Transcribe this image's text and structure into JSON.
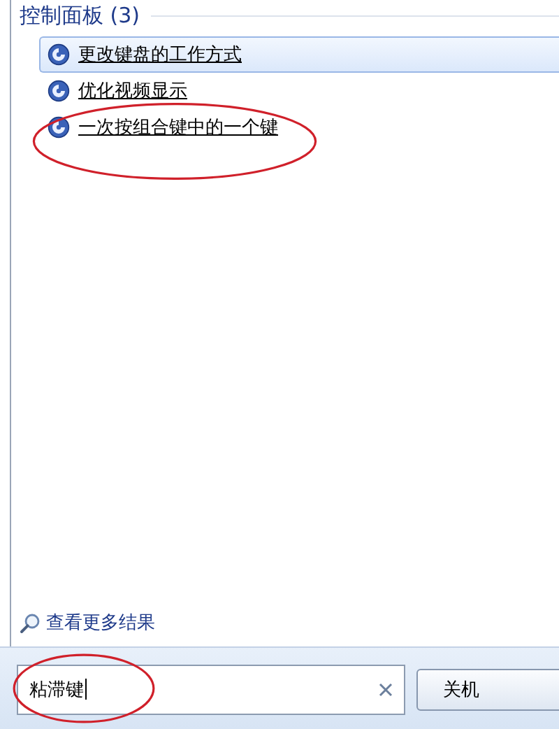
{
  "group": {
    "title": "控制面板 (3)",
    "items": [
      {
        "label": "更改键盘的工作方式",
        "selected": true,
        "circled": false
      },
      {
        "label": "优化视频显示",
        "selected": false,
        "circled": false
      },
      {
        "label": "一次按组合键中的一个键",
        "selected": false,
        "circled": true
      }
    ]
  },
  "more_results": "查看更多结果",
  "search": {
    "value": "粘滞键",
    "circled": true
  },
  "shutdown_button": "关机"
}
